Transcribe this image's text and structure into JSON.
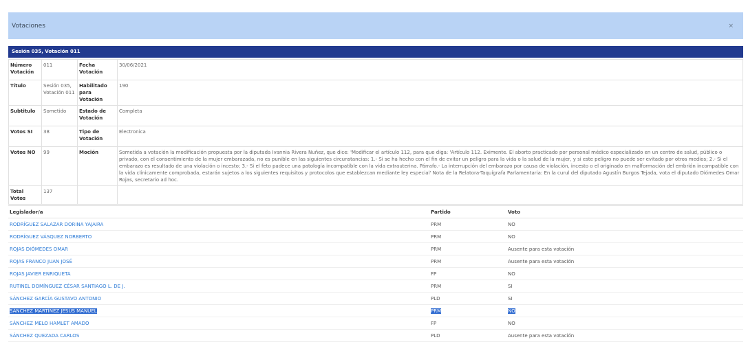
{
  "modal": {
    "title": "Votaciones",
    "close": "×"
  },
  "session_header": "Sesión 035, Votación 011",
  "info": {
    "numero_label": "Número Votación",
    "numero": "011",
    "fecha_label": "Fecha Votación",
    "fecha": "30/06/2021",
    "titulo_label": "Título",
    "titulo": "Sesión 035, Votación 011",
    "habilitado_label": "Habilitado para Votación",
    "habilitado": "190",
    "subtitulo_label": "Subtitulo",
    "subtitulo": "Sometido",
    "estado_label": "Estado de Votación",
    "estado": "Completa",
    "votos_si_label": "Votos SI",
    "votos_si": "38",
    "tipo_label": "Tipo de Votación",
    "tipo": "Electronica",
    "votos_no_label": "Votos NO",
    "votos_no": "99",
    "mocion_label": "Moción",
    "mocion": "Sometida a votación la modificación propuesta por la diputada Ivannia Rivera Nuñez, que dice: 'Modificar el artículo 112, para que diga: 'Artículo 112. Eximente. El aborto practicado por personal médico especializado en un centro de salud, público o privado, con el consentimiento de la mujer embarazada, no es punible en las siguientes circunstancias: 1.- Si se ha hecho con el fin de evitar un peligro para la vida o la salud de la mujer, y si este peligro no puede ser evitado por otros medios; 2.- Si el embarazo es resultado de una violación o incesto; 3.- Si el feto padece una patología incompatible con la vida extrauterina. Párrafo.- La interrupción del embarazo por causa de violación, incesto o el originado en malformación del embrión incompatible con la vida clínicamente comprobada, estarán sujetos a los siguientes requisitos y protocolos que establezcan mediante ley especial' Nota de la Relatora-Taquígrafa Parlamentaria: En la curul del diputado Agustín Burgos Tejada, vota el diputado Diómedes Omar Rojas, secretario ad hoc.",
    "total_label": "Total Votos",
    "total": "137"
  },
  "list": {
    "headers": {
      "legislador": "Legislador/a",
      "partido": "Partido",
      "voto": "Voto"
    },
    "rows": [
      {
        "name": "RODRÍGUEZ SALAZAR DORINA YAJAIRA",
        "partido": "PRM",
        "voto": "NO"
      },
      {
        "name": "RODRÍGUEZ VÁSQUEZ NORBERTO",
        "partido": "PRM",
        "voto": "NO"
      },
      {
        "name": "ROJAS DIÓMEDES OMAR",
        "partido": "PRM",
        "voto": "Ausente para esta votación"
      },
      {
        "name": "ROJAS FRANCO JUAN JOSÉ",
        "partido": "PRM",
        "voto": "Ausente para esta votación"
      },
      {
        "name": "ROJAS JAVIER ENRIQUETA",
        "partido": "FP",
        "voto": "NO"
      },
      {
        "name": "RUTINEL DOMÍNGUEZ CÉSAR SANTIAGO L. DE J.",
        "partido": "PRM",
        "voto": "SI"
      },
      {
        "name": "SÁNCHEZ GARCÍA GUSTAVO ANTONIO",
        "partido": "PLD",
        "voto": "SI"
      },
      {
        "name": "SÁNCHEZ MARTÍNEZ JESÚS MANUEL",
        "partido": "PRM",
        "voto": "NO"
      },
      {
        "name": "SÁNCHEZ MELO HAMLET AMADO",
        "partido": "FP",
        "voto": "NO"
      },
      {
        "name": "SÁNCHEZ QUEZADA CARLOS",
        "partido": "PLD",
        "voto": "Ausente para esta votación"
      }
    ]
  }
}
